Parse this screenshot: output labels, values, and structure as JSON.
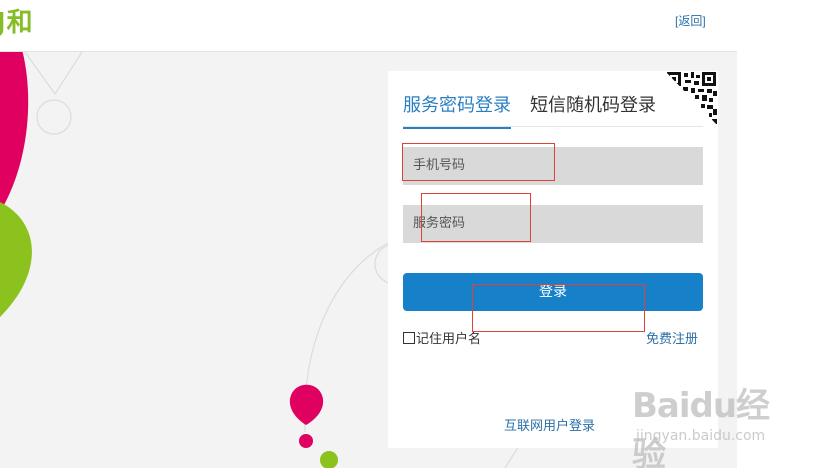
{
  "header": {
    "logo_text": "J和",
    "back_label": "[返回]"
  },
  "login_panel": {
    "tabs": [
      {
        "label": "服务密码登录",
        "active": true
      },
      {
        "label": "短信随机码登录",
        "active": false
      }
    ],
    "phone_placeholder": "手机号码",
    "password_placeholder": "服务密码",
    "login_button": "登录",
    "remember_label": "记住用户名",
    "register_label": "免费注册",
    "internet_login_label": "互联网用户登录",
    "qr_icon": "qr-code-icon"
  },
  "watermark": {
    "main": "Baidu经验",
    "sub": "jingyan.baidu.com"
  },
  "colors": {
    "accent_blue": "#1681c8",
    "link_blue": "#2a6fa8",
    "brand_green": "#86bc25",
    "magenta": "#e0005f",
    "annotation_red": "#e0403a"
  }
}
